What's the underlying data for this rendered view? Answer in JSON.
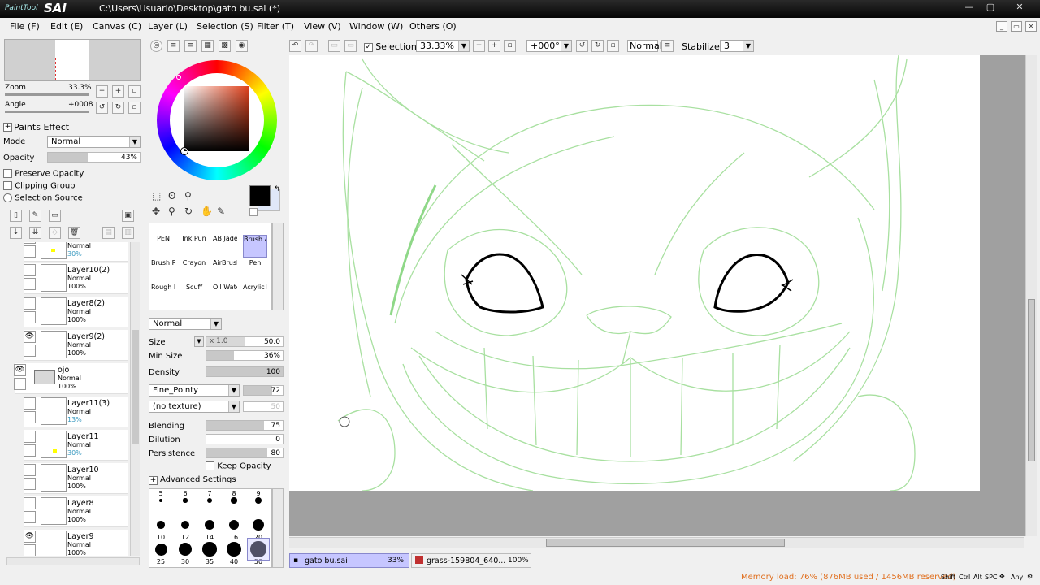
{
  "app": {
    "logo_small": "PaintTool",
    "logo_big": "SAI",
    "title": "C:\\Users\\Usuario\\Desktop\\gato bu.sai (*)",
    "min": "—",
    "max": "▢",
    "close": "✕"
  },
  "menu": [
    "File (F)",
    "Edit (E)",
    "Canvas (C)",
    "Layer (L)",
    "Selection (S)",
    "Filter (T)",
    "View (V)",
    "Window (W)",
    "Others (O)"
  ],
  "navigator": {
    "zoom_label": "Zoom",
    "zoom_value": "33.3%",
    "angle_label": "Angle",
    "angle_value": "+0008"
  },
  "paints_effect": {
    "header": "Paints Effect",
    "mode_label": "Mode",
    "mode_value": "Normal",
    "opacity_label": "Opacity",
    "opacity_value": "43%",
    "opacity_level": 0.43,
    "preserve_opacity": "Preserve Opacity",
    "clipping_group": "Clipping Group",
    "selection_source": "Selection Source"
  },
  "layers": [
    {
      "name": "",
      "mode": "Normal",
      "opacity": "30%",
      "visible": false
    },
    {
      "name": "Layer10(2)",
      "mode": "Normal",
      "opacity": "100%",
      "visible": false
    },
    {
      "name": "Layer8(2)",
      "mode": "Normal",
      "opacity": "100%",
      "visible": false
    },
    {
      "name": "Layer9(2)",
      "mode": "Normal",
      "opacity": "100%",
      "visible": true
    },
    {
      "name": "ojo",
      "mode": "Normal",
      "opacity": "100%",
      "visible": true,
      "folder": true
    },
    {
      "name": "Layer11(3)",
      "mode": "Normal",
      "opacity": "13%",
      "visible": false
    },
    {
      "name": "Layer11",
      "mode": "Normal",
      "opacity": "30%",
      "visible": false
    },
    {
      "name": "Layer10",
      "mode": "Normal",
      "opacity": "100%",
      "visible": false
    },
    {
      "name": "Layer8",
      "mode": "Normal",
      "opacity": "100%",
      "visible": false
    },
    {
      "name": "Layer9",
      "mode": "Normal",
      "opacity": "100%",
      "visible": true
    }
  ],
  "colors": {
    "primary": "#000000",
    "hue_square": "#e0401a",
    "canvas_line": "#a8e0a0",
    "selected_tab": "#c6c6ff",
    "status_text": "#e07020"
  },
  "brushes": [
    "PEN",
    "Ink Pun",
    "AB Jade",
    "Brush Ar",
    "Brush Ro",
    "Crayon",
    "AirBrush",
    "Pen",
    "Rough P",
    "Scuff",
    "Oil Wate",
    "Acrylic L"
  ],
  "brush_settings": {
    "blend_mode": "Normal",
    "size_label": "Size",
    "size_mult": "x 1.0",
    "size_value": "50.0",
    "min_size_label": "Min Size",
    "min_size_value": "36%",
    "density_label": "Density",
    "density_value": "100",
    "shape": "Fine_Pointy",
    "shape_value": "72",
    "texture": "(no texture)",
    "texture_value": "50",
    "blending_label": "Blending",
    "blending_value": "75",
    "dilution_label": "Dilution",
    "dilution_value": "0",
    "persistence_label": "Persistence",
    "persistence_value": "80",
    "keep_opacity": "Keep Opacity",
    "advanced": "Advanced Settings"
  },
  "brush_sizes": [
    "5",
    "6",
    "7",
    "8",
    "9",
    "10",
    "12",
    "14",
    "16",
    "20",
    "25",
    "30",
    "35",
    "40",
    "50"
  ],
  "toolbar": {
    "selection": "Selection",
    "zoom": "33.33%",
    "angle": "+000°",
    "blend": "Normal",
    "stabilizer_label": "Stabilizer",
    "stabilizer_value": "3"
  },
  "tabs": [
    {
      "name": "gato bu.sai",
      "zoom": "33%"
    },
    {
      "name": "grass-159804_640...",
      "zoom": "100%"
    }
  ],
  "status": {
    "memory": "Memory load: 76% (876MB used / 1456MB reserved)",
    "keys": [
      "Shift",
      "Ctrl",
      "Alt",
      "SPC",
      "Any"
    ]
  }
}
